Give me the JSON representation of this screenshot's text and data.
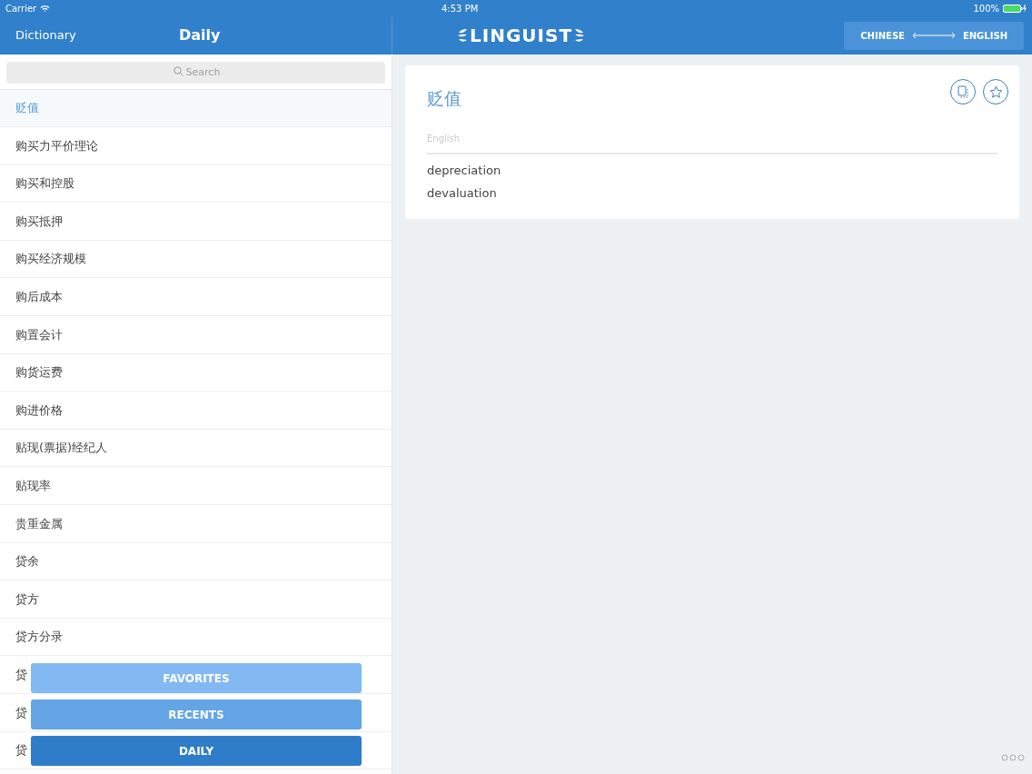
{
  "status_bar": {
    "carrier": "Carrier",
    "time": "4:53 PM",
    "battery": "100%"
  },
  "sidebar": {
    "back": "Dictionary",
    "title": "Daily",
    "search": {
      "placeholder": "Search"
    },
    "items": [
      {
        "label": "贬值",
        "selected": true
      },
      {
        "label": "购买力平价理论",
        "selected": false
      },
      {
        "label": "购买和控股",
        "selected": false
      },
      {
        "label": "购买抵押",
        "selected": false
      },
      {
        "label": "购买经济规模",
        "selected": false
      },
      {
        "label": "购后成本",
        "selected": false
      },
      {
        "label": "购置会计",
        "selected": false
      },
      {
        "label": "购货运费",
        "selected": false
      },
      {
        "label": "购进价格",
        "selected": false
      },
      {
        "label": "贴现(票据)经纪人",
        "selected": false
      },
      {
        "label": "贴现率",
        "selected": false
      },
      {
        "label": "贵重金属",
        "selected": false
      },
      {
        "label": "贷余",
        "selected": false
      },
      {
        "label": "贷方",
        "selected": false
      },
      {
        "label": "贷方分录",
        "selected": false
      },
      {
        "label": "贷",
        "selected": false
      },
      {
        "label": "贷",
        "selected": false
      },
      {
        "label": "贷",
        "selected": false
      }
    ],
    "modes": [
      {
        "label": "FAVORITES",
        "selected": false
      },
      {
        "label": "RECENTS",
        "selected": false
      },
      {
        "label": "DAILY",
        "selected": true
      }
    ]
  },
  "header": {
    "logo": "LINGUIST",
    "language_from": "CHINESE",
    "language_to": "ENGLISH"
  },
  "entry": {
    "term": "贬值",
    "section": "English",
    "translations": [
      "depreciation",
      "devaluation"
    ]
  }
}
